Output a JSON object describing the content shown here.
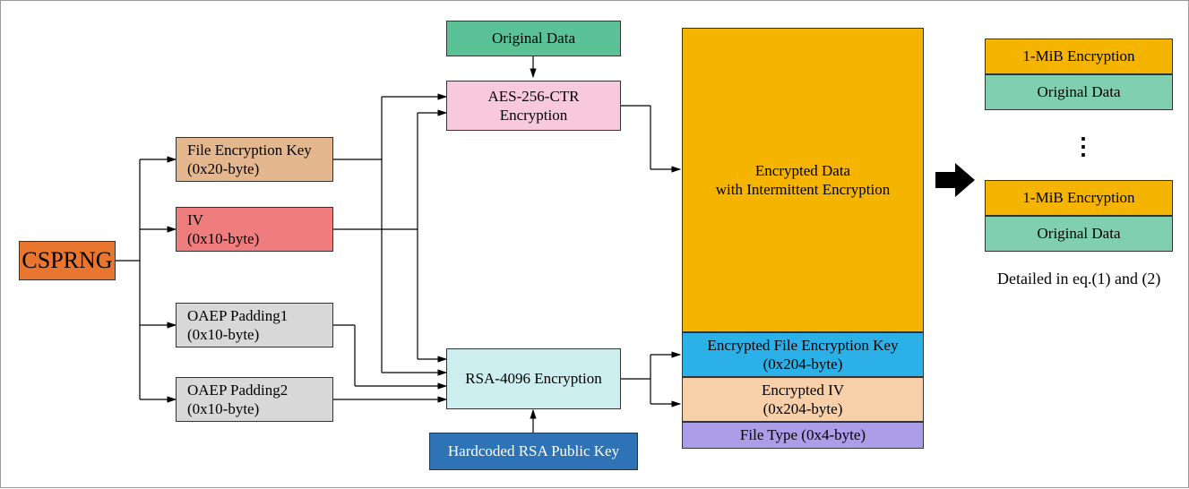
{
  "csprng": "CSPRNG",
  "file_key": {
    "l1": "File Encryption Key",
    "l2": "(0x20-byte)"
  },
  "iv": {
    "l1": "IV",
    "l2": "(0x10-byte)"
  },
  "oaep1": {
    "l1": "OAEP Padding1",
    "l2": "(0x10-byte)"
  },
  "oaep2": {
    "l1": "OAEP Padding2",
    "l2": "(0x10-byte)"
  },
  "aes": {
    "l1": "AES-256-CTR",
    "l2": "Encryption"
  },
  "rsa": "RSA-4096 Encryption",
  "orig": "Original Data",
  "rsa_pub": "Hardcoded RSA Public Key",
  "enc_data": {
    "l1": "Encrypted Data",
    "l2": "with Intermittent Encryption"
  },
  "enc_key": {
    "l1": "Encrypted File Encryption Key",
    "l2": "(0x204-byte)"
  },
  "enc_iv": {
    "l1": "Encrypted IV",
    "l2": "(0x204-byte)"
  },
  "ftype": "File Type (0x4-byte)",
  "right_blocks": {
    "a": "1-MiB Encryption",
    "b": "Original Data",
    "c": "1-MiB Encryption",
    "d": "Original Data"
  },
  "dots": "⋮",
  "detail_caption": "Detailed in eq.(1) and (2)"
}
